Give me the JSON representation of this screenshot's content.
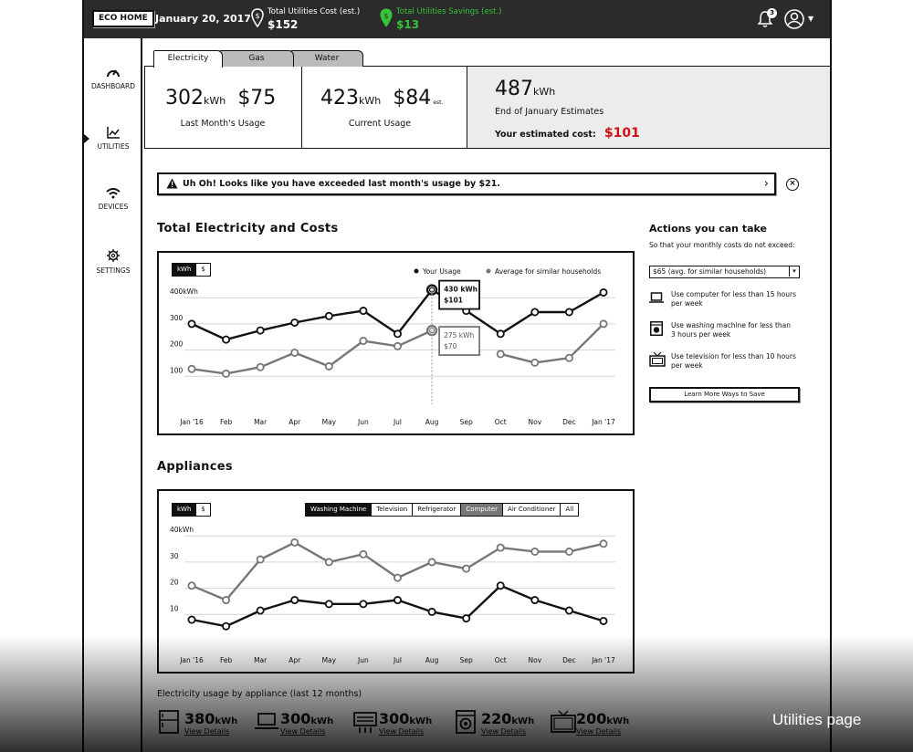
{
  "topbar": {
    "logo": "ECO HOME",
    "date": "January 20, 2017",
    "cost_label": "Total Utilities Cost (est.)",
    "cost_value": "$152",
    "savings_label": "Total Utilities Savings (est.)",
    "savings_value": "$13",
    "notification_count": "3",
    "savings_color": "#35c435"
  },
  "sidebar": {
    "items": [
      {
        "label": "DASHBOARD",
        "icon": "gauge-icon"
      },
      {
        "label": "UTILITIES",
        "icon": "chart-icon",
        "active": true
      },
      {
        "label": "DEVICES",
        "icon": "wifi-icon"
      },
      {
        "label": "SETTINGS",
        "icon": "gear-icon"
      }
    ]
  },
  "tabs": [
    "Electricity",
    "Gas",
    "Water"
  ],
  "cards": {
    "last_month": {
      "kwh": "302",
      "unit": "kWh",
      "cost": "$75",
      "label": "Last Month's Usage"
    },
    "current": {
      "kwh": "423",
      "unit": "kWh",
      "cost": "$84",
      "est": "est.",
      "label": "Current Usage"
    },
    "estimate": {
      "kwh": "487",
      "unit": "kWh",
      "label": "End of January Estimates",
      "cost_label": "Your estimated cost:",
      "cost": "$101",
      "cost_color": "#cc1111"
    }
  },
  "alert": {
    "text": "Uh Oh! Looks like you have exceeded last month's usage by $21."
  },
  "electricity": {
    "title": "Total Electricity and Costs",
    "toggle": [
      "kWh",
      "$"
    ],
    "legend": [
      "Your Usage",
      "Average for similar households"
    ],
    "tooltip_usage": {
      "kwh": "430 kWh",
      "cost": "$101"
    },
    "tooltip_avg": {
      "kwh": "275 kWh",
      "cost": "$70"
    },
    "y_ticks": [
      "400kWh",
      "300",
      "200",
      "100"
    ],
    "x_ticks": [
      "Jan '16",
      "Feb",
      "Mar",
      "Apr",
      "May",
      "Jun",
      "Jul",
      "Aug",
      "Sep",
      "Oct",
      "Nov",
      "Dec",
      "Jan '17"
    ]
  },
  "actions": {
    "title": "Actions you can take",
    "subtitle": "So that your monthly costs do not exceed:",
    "dropdown_value": "$65 (avg. for similar households)",
    "tips": [
      {
        "icon": "laptop-icon",
        "line1": "Use computer for less than 15 hours",
        "line2": "per week"
      },
      {
        "icon": "washer-icon",
        "line1": "Use washing machine for less than",
        "line2": "3 hours per week"
      },
      {
        "icon": "tv-icon",
        "line1": "Use television for less than 10 hours",
        "line2": "per week"
      }
    ],
    "button": "Learn More Ways to Save"
  },
  "appliances": {
    "title": "Appliances",
    "toggle": [
      "kWh",
      "$"
    ],
    "filters": [
      "Washing Machine",
      "Television",
      "Refrigerator",
      "Computer",
      "Air Conditioner",
      "All"
    ],
    "y_ticks": [
      "40kWh",
      "30",
      "20",
      "10"
    ],
    "x_ticks": [
      "Jan '16",
      "Feb",
      "Mar",
      "Apr",
      "May",
      "Jun",
      "Jul",
      "Aug",
      "Sep",
      "Oct",
      "Nov",
      "Dec",
      "Jan '17"
    ],
    "caption": "Electricity usage by appliance (last 12 months)",
    "summary": [
      {
        "icon": "fridge-icon",
        "value": "380",
        "unit": "kWh",
        "link": "View Details"
      },
      {
        "icon": "laptop-icon",
        "value": "300",
        "unit": "kWh",
        "link": "View Details"
      },
      {
        "icon": "heater-icon",
        "value": "300",
        "unit": "kWh",
        "link": "View Details"
      },
      {
        "icon": "washer-icon",
        "value": "220",
        "unit": "kWh",
        "link": "View Details"
      },
      {
        "icon": "tv-icon",
        "value": "200",
        "unit": "kWh",
        "link": "View Details"
      }
    ]
  },
  "footer_caption": "Utilities page",
  "chart_data": [
    {
      "type": "line",
      "title": "Total Electricity and Costs",
      "x": [
        "Jan '16",
        "Feb",
        "Mar",
        "Apr",
        "May",
        "Jun",
        "Jul",
        "Aug",
        "Sep",
        "Oct",
        "Nov",
        "Dec",
        "Jan '17"
      ],
      "ylim": [
        0,
        450
      ],
      "series": [
        {
          "name": "Your Usage",
          "color": "#111111",
          "values": [
            300,
            240,
            275,
            305,
            330,
            350,
            262,
            430,
            350,
            262,
            345,
            345,
            420
          ]
        },
        {
          "name": "Average for similar households",
          "color": "#777777",
          "values": [
            128,
            110,
            135,
            190,
            138,
            235,
            215,
            275,
            null,
            185,
            152,
            170,
            300
          ]
        }
      ]
    },
    {
      "type": "line",
      "title": "Appliances",
      "x": [
        "Jan '16",
        "Feb",
        "Mar",
        "Apr",
        "May",
        "Jun",
        "Jul",
        "Aug",
        "Sep",
        "Oct",
        "Nov",
        "Dec",
        "Jan '17"
      ],
      "ylim": [
        0,
        45
      ],
      "series": [
        {
          "color": "#777777",
          "values": [
            21,
            15.5,
            31,
            37.5,
            30,
            33,
            24,
            30,
            27.5,
            35.5,
            34,
            34,
            37
          ]
        },
        {
          "color": "#111111",
          "values": [
            8,
            5.5,
            11.5,
            15.5,
            14,
            14,
            15.5,
            11,
            8.5,
            21,
            15.5,
            11.5,
            7.5
          ]
        }
      ]
    }
  ]
}
